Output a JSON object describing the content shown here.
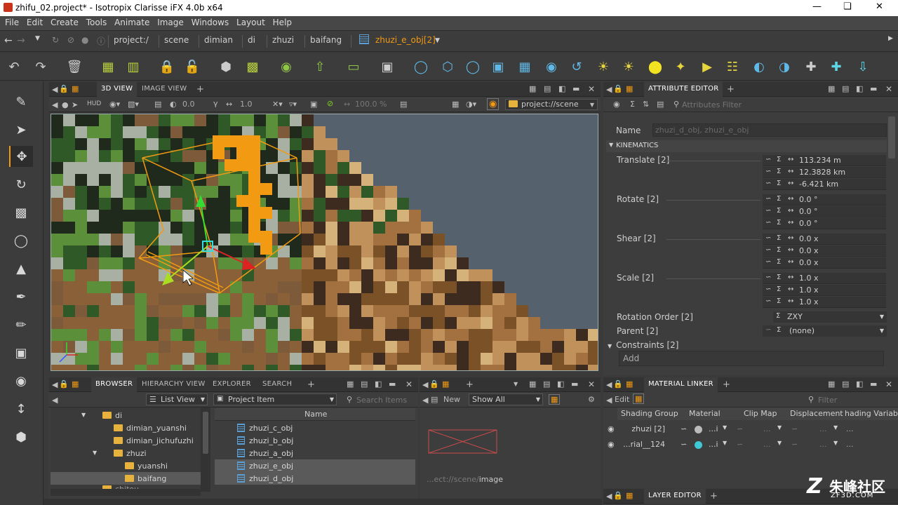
{
  "window": {
    "title": "zhifu_02.project* - Isotropix Clarisse iFX 4.0b x64"
  },
  "menu": [
    "File",
    "Edit",
    "Create",
    "Tools",
    "Animate",
    "Image",
    "Windows",
    "Layout",
    "Help"
  ],
  "breadcrumbs": [
    "project:/",
    "scene",
    "dimian",
    "di",
    "zhuzi",
    "baifang",
    "zhuzi_e_obj[2]"
  ],
  "viewport_panel": {
    "tabs": [
      "3D VIEW",
      "IMAGE VIEW"
    ],
    "hud": "HUD",
    "field1": "0.0",
    "field2": "1.0",
    "percent": "100.0 %",
    "context": "project://scene"
  },
  "attribute_editor": {
    "title": "ATTRIBUTE EDITOR",
    "filter_placeholder": "Attributes Filter",
    "name_label": "Name",
    "name_value": "zhuzi_d_obj, zhuzi_e_obj",
    "section": "KINEMATICS",
    "translate": {
      "label": "Translate [2]",
      "values": [
        "113.234 m",
        "12.3828 km",
        "-6.421 km"
      ]
    },
    "rotate": {
      "label": "Rotate [2]",
      "values": [
        "0.0 °",
        "0.0 °",
        "0.0 °"
      ]
    },
    "shear": {
      "label": "Shear [2]",
      "values": [
        "0.0 x",
        "0.0 x",
        "0.0 x"
      ]
    },
    "scale": {
      "label": "Scale [2]",
      "values": [
        "1.0 x",
        "1.0 x",
        "1.0 x"
      ]
    },
    "rotation_order": {
      "label": "Rotation Order [2]",
      "value": "ZXY"
    },
    "parent": {
      "label": "Parent [2]",
      "value": "(none)"
    },
    "constraints": {
      "label": "Constraints [2]",
      "add": "Add"
    }
  },
  "browser": {
    "tabs": [
      "BROWSER",
      "HIERARCHY VIEW",
      "EXPLORER",
      "SEARCH"
    ],
    "view_mode": "List View",
    "item_type": "Project Item",
    "search_placeholder": "Search Items",
    "column_name": "Name",
    "tree": [
      {
        "label": "di",
        "indent": 0
      },
      {
        "label": "dimian_yuanshi",
        "indent": 1
      },
      {
        "label": "dimian_jichufuzhi",
        "indent": 1
      },
      {
        "label": "zhuzi",
        "indent": 1
      },
      {
        "label": "yuanshi",
        "indent": 2
      },
      {
        "label": "baifang",
        "indent": 2
      }
    ],
    "tree_more": "chitou",
    "files": [
      "zhuzi_c_obj",
      "zhuzi_b_obj",
      "zhuzi_a_obj",
      "zhuzi_e_obj",
      "zhuzi_d_obj"
    ]
  },
  "image_panel": {
    "new_label": "New",
    "show": "Show All",
    "path_prefix": "...ect://scene/",
    "path_suffix": "image"
  },
  "material_linker": {
    "title": "MATERIAL LINKER",
    "edit": "Edit",
    "filter_placeholder": "Filter",
    "columns": [
      "Shading Group",
      "Material",
      "Clip Map",
      "Displacement",
      "hading Variabl"
    ],
    "rows": [
      {
        "group": "zhuzi [2]"
      },
      {
        "group": "...rial__124"
      }
    ],
    "cell": "...i"
  },
  "layer_editor": {
    "title": "LAYER EDITOR"
  },
  "watermark": {
    "text": "朱峰社区",
    "sub": "ZF3D.COM"
  },
  "colors": {
    "accent": "#f29a12",
    "panel": "#3c3c3c",
    "highlight": "#5a9fd6"
  }
}
